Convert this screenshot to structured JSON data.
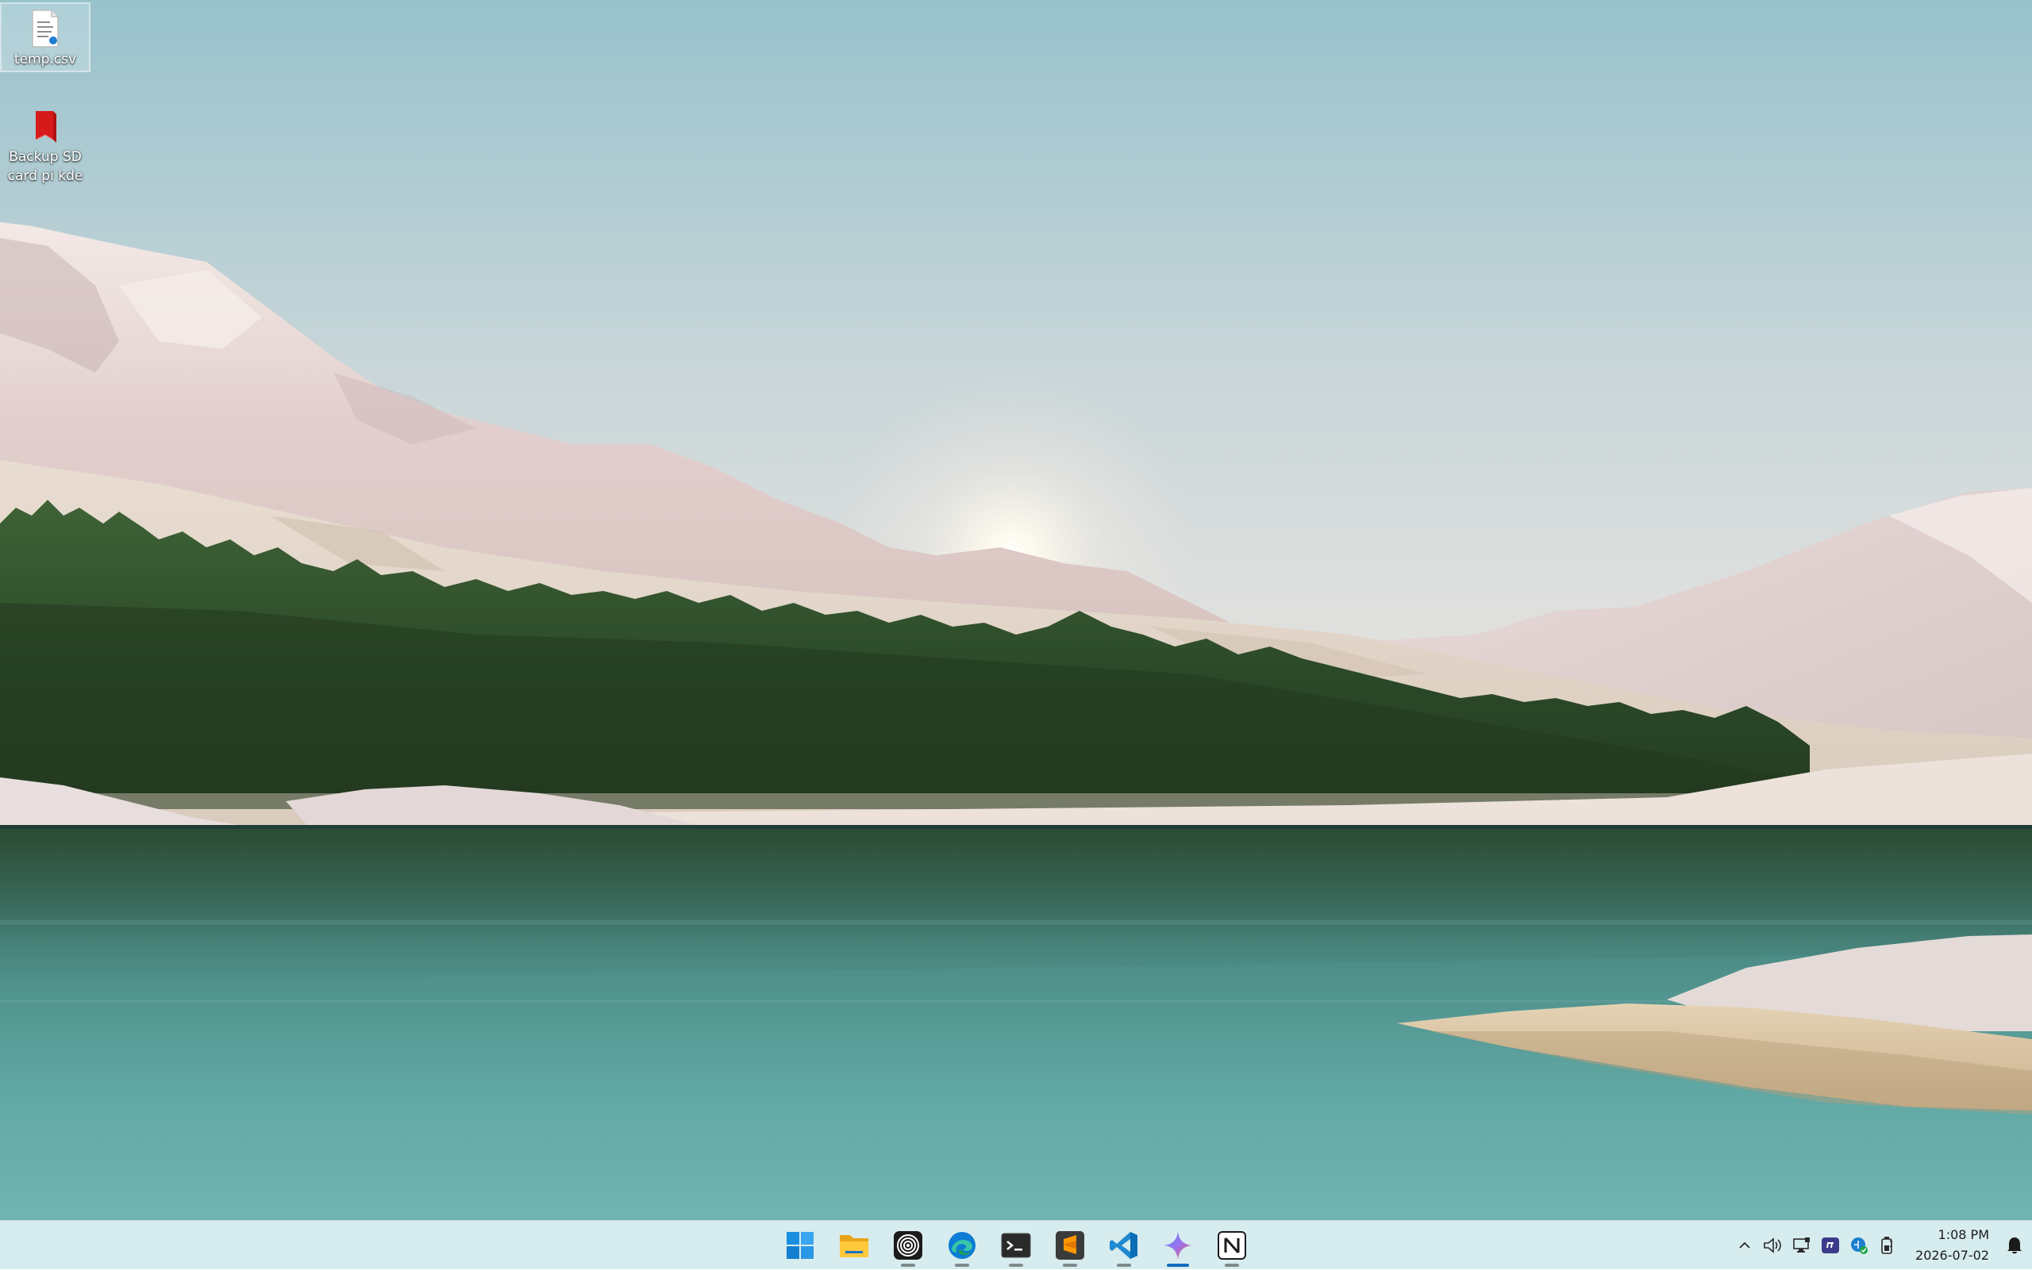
{
  "desktop": {
    "icons": [
      {
        "label": "temp.csv",
        "icon": "csv-file-icon"
      },
      {
        "label": "Backup SD card pi kde",
        "icon": "red-folder-icon"
      }
    ]
  },
  "taskbar": {
    "apps": [
      {
        "name": "Start",
        "icon": "windows-logo-icon"
      },
      {
        "name": "File Explorer",
        "icon": "folder-icon"
      },
      {
        "name": "Unknown app",
        "icon": "concentric-circles-icon"
      },
      {
        "name": "Microsoft Edge",
        "icon": "edge-icon"
      },
      {
        "name": "Terminal",
        "icon": "terminal-icon"
      },
      {
        "name": "Sublime Text",
        "icon": "sublime-text-icon"
      },
      {
        "name": "Visual Studio Code",
        "icon": "vscode-icon"
      },
      {
        "name": "Gemini",
        "icon": "sparkle-icon"
      },
      {
        "name": "Notion",
        "icon": "notion-icon"
      }
    ],
    "tray": {
      "icons": [
        "chevron-up-icon",
        "speaker-icon",
        "network-icon",
        "discord-icon",
        "shield-icon",
        "battery-icon"
      ],
      "time": "1:08 PM",
      "date": "2026-07-02"
    }
  },
  "colors": {
    "taskbar_bg": "#d7ecee",
    "accent": "#0f6cbd",
    "sky": "#9bc3cc",
    "lake": "#5a9894",
    "forest": "#2f4b2a"
  }
}
